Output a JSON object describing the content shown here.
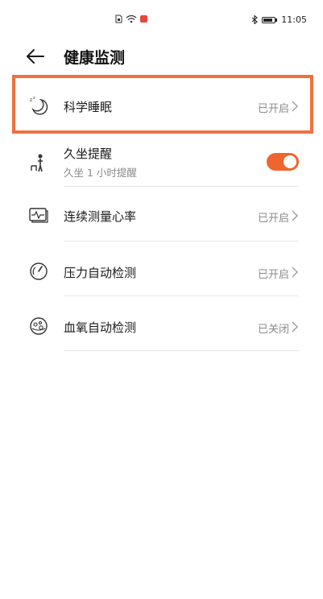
{
  "status_bar": {
    "time": "11:05",
    "center_icons": [
      "sim-icon",
      "wifi-icon",
      "app-notification-icon"
    ],
    "right_icons": [
      "bluetooth-icon",
      "battery-icon"
    ],
    "accent": "#e8473b"
  },
  "header": {
    "title": "健康监测",
    "back_icon": "arrow-left-icon"
  },
  "items": [
    {
      "id": "sleep",
      "label": "科学睡眠",
      "value": "已开启",
      "icon": "moon-sleep-icon"
    },
    {
      "id": "sedentary",
      "label": "久坐提醒",
      "sublabel": "久坐 1 小时提醒",
      "toggle_on": true,
      "icon": "sedentary-person-icon"
    },
    {
      "id": "heart-rate",
      "label": "连续测量心率",
      "value": "已开启",
      "icon": "heart-rate-monitor-icon"
    },
    {
      "id": "stress",
      "label": "压力自动检测",
      "value": "已开启",
      "icon": "gauge-icon"
    },
    {
      "id": "spo2",
      "label": "血氧自动检测",
      "value": "已关闭",
      "icon": "blood-oxygen-icon"
    }
  ],
  "colors": {
    "highlight_border": "#f07040",
    "toggle_on": "#f0642e",
    "secondary_text": "#8a8a8a"
  }
}
